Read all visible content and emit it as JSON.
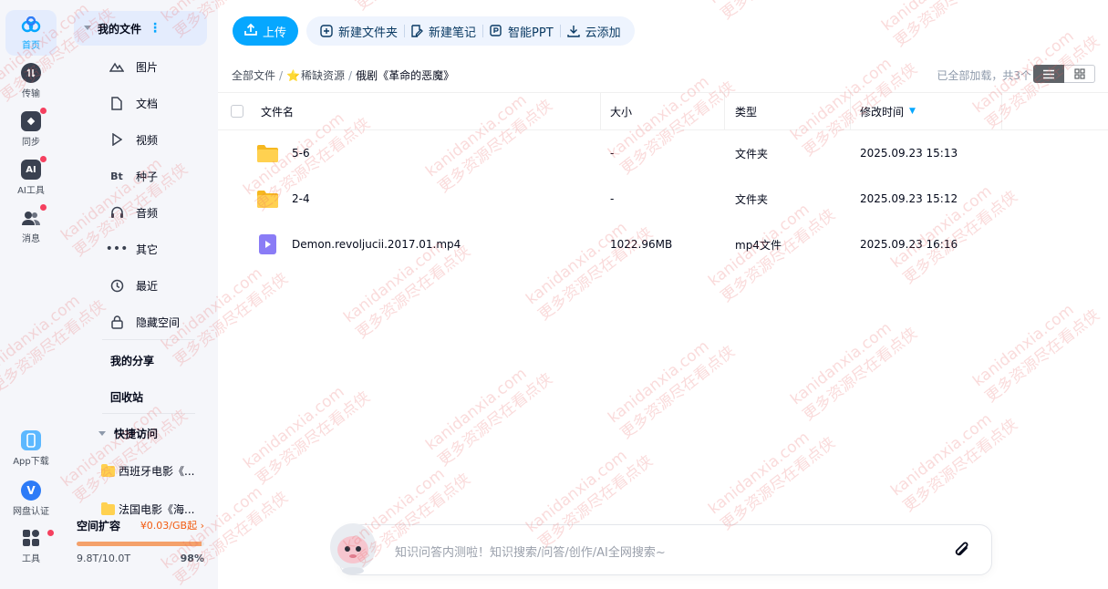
{
  "rail": {
    "items": [
      {
        "label": "首页",
        "active": true
      },
      {
        "label": "传输"
      },
      {
        "label": "同步",
        "badge": true
      },
      {
        "label": "AI工具",
        "badge": true
      },
      {
        "label": "消息",
        "badge": true
      }
    ],
    "bottom": [
      {
        "label": "App下载"
      },
      {
        "label": "网盘认证"
      },
      {
        "label": "工具",
        "badge": true
      }
    ]
  },
  "sidebar": {
    "my_files": "我的文件",
    "categories": [
      "图片",
      "文档",
      "视频",
      "种子",
      "音频",
      "其它",
      "最近",
      "隐藏空间"
    ],
    "seed_icon": "Bt",
    "my_share": "我的分享",
    "recycle": "回收站",
    "quick_access": "快捷访问",
    "quick_items": [
      "西班牙电影《...",
      "法国电影《海..."
    ],
    "storage": {
      "title": "空间扩容",
      "price": "¥0.03/GB起",
      "used": "9.8T/10.0T",
      "percent": "98%",
      "fraction": 0.98
    }
  },
  "toolbar": {
    "upload": "上传",
    "new_folder": "新建文件夹",
    "new_note": "新建笔记",
    "smart_ppt": "智能PPT",
    "cloud_add": "云添加"
  },
  "breadcrumb": {
    "root": "全部文件",
    "level1": "稀缺资源",
    "current": "俄剧《革命的恶魔》",
    "star": "⭐"
  },
  "count_text": "已全部加载，共3个",
  "table": {
    "headers": {
      "name": "文件名",
      "size": "大小",
      "type": "类型",
      "modified": "修改时间"
    },
    "rows": [
      {
        "name": "5-6",
        "size": "-",
        "type": "文件夹",
        "modified": "2025.09.23 15:13",
        "kind": "folder"
      },
      {
        "name": "2-4",
        "size": "-",
        "type": "文件夹",
        "modified": "2025.09.23 15:12",
        "kind": "folder"
      },
      {
        "name": "Demon.revoljucii.2017.01.mp4",
        "size": "1022.96MB",
        "type": "mp4文件",
        "modified": "2025.09.23 16:16",
        "kind": "video"
      }
    ]
  },
  "ask": {
    "placeholder": "知识问答内测啦！知识搜索/问答/创作/AI全网搜索~"
  },
  "watermark": {
    "line1": "kanidanxia.com",
    "line2": "更多资源尽在看点侠"
  },
  "colors": {
    "accent": "#06a7ff",
    "folder": "#ffd150",
    "video": "#8a7cf6",
    "badge": "#f5405f"
  }
}
